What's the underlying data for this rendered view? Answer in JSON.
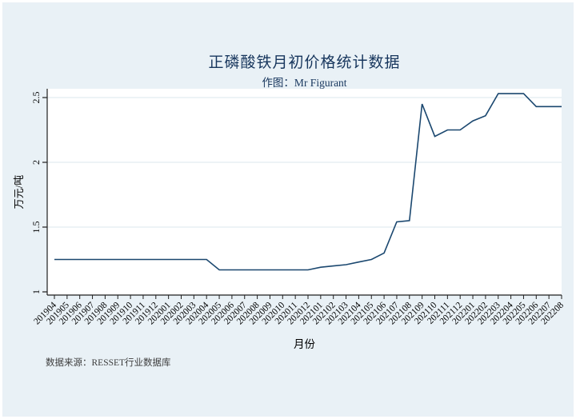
{
  "page": {
    "title": "正磷酸铁月初价格统计数据",
    "subtitle": "作图：Mr Figurant",
    "source_note": "数据来源：RESSET行业数据库"
  },
  "chart_data": {
    "type": "line",
    "title": "正磷酸铁月初价格统计数据",
    "subtitle": "作图：Mr Figurant",
    "xlabel": "月份",
    "ylabel": "万元/吨",
    "source": "数据来源：RESSET行业数据库",
    "ylim": [
      1,
      2.5
    ],
    "yticks": [
      1,
      1.5,
      2,
      2.5
    ],
    "ytick_labels": [
      "1",
      "1.5",
      "2",
      "2.5"
    ],
    "grid": true,
    "legend": "none",
    "x_tick_rotation": 45,
    "y_tick_rotation": 90,
    "colors": {
      "line": "#1a476f",
      "background": "#e9f1f6",
      "plot_background": "#ffffff",
      "gridline": "#e2ecf0",
      "axis": "#1f1f1f",
      "title_text": "#17365d",
      "tick_text": "#000000"
    },
    "categories": [
      "201904",
      "201905",
      "201906",
      "201907",
      "201908",
      "201909",
      "201910",
      "201911",
      "201912",
      "202001",
      "202002",
      "202003",
      "202004",
      "202005",
      "202006",
      "202007",
      "202008",
      "202009",
      "202010",
      "202011",
      "202012",
      "202101",
      "202102",
      "202103",
      "202104",
      "202105",
      "202106",
      "202107",
      "202108",
      "202109",
      "202110",
      "202111",
      "202112",
      "202201",
      "202202",
      "202203",
      "202204",
      "202205",
      "202206",
      "202207",
      "202208"
    ],
    "values": [
      1.25,
      1.25,
      1.25,
      1.25,
      1.25,
      1.25,
      1.25,
      1.25,
      1.25,
      1.25,
      1.25,
      1.25,
      1.25,
      1.17,
      1.17,
      1.17,
      1.17,
      1.17,
      1.17,
      1.17,
      1.17,
      1.19,
      1.2,
      1.21,
      1.23,
      1.25,
      1.3,
      1.54,
      1.55,
      2.45,
      2.2,
      2.25,
      2.25,
      2.32,
      2.36,
      2.53,
      2.53,
      2.53,
      2.43,
      2.43,
      2.43
    ]
  }
}
